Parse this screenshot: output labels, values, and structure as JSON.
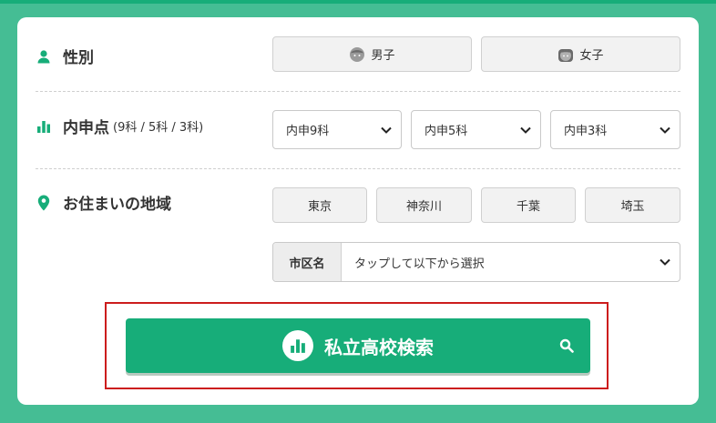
{
  "colors": {
    "page_bg": "#45bd94",
    "accent": "#17ad79",
    "card_bg": "#ffffff",
    "highlight": "#cc1c1c"
  },
  "gender": {
    "label": "性別",
    "icon": "person-icon",
    "options": [
      {
        "label": "男子",
        "icon": "boy-face-icon"
      },
      {
        "label": "女子",
        "icon": "girl-face-icon"
      }
    ]
  },
  "grades": {
    "label": "内申点",
    "sub_label": "(9科 / 5科 / 3科)",
    "icon": "bar-chart-icon",
    "selects": [
      {
        "value": "内申9科"
      },
      {
        "value": "内申5科"
      },
      {
        "value": "内申3科"
      }
    ]
  },
  "residence": {
    "label": "お住まいの地域",
    "icon": "map-pin-icon",
    "prefectures": [
      "東京",
      "神奈川",
      "千葉",
      "埼玉"
    ],
    "city_label": "市区名",
    "city_value": "タップして以下から選択"
  },
  "search": {
    "label": "私立高校検索",
    "icon": "bar-chart-icon",
    "search_icon": "search-icon"
  }
}
